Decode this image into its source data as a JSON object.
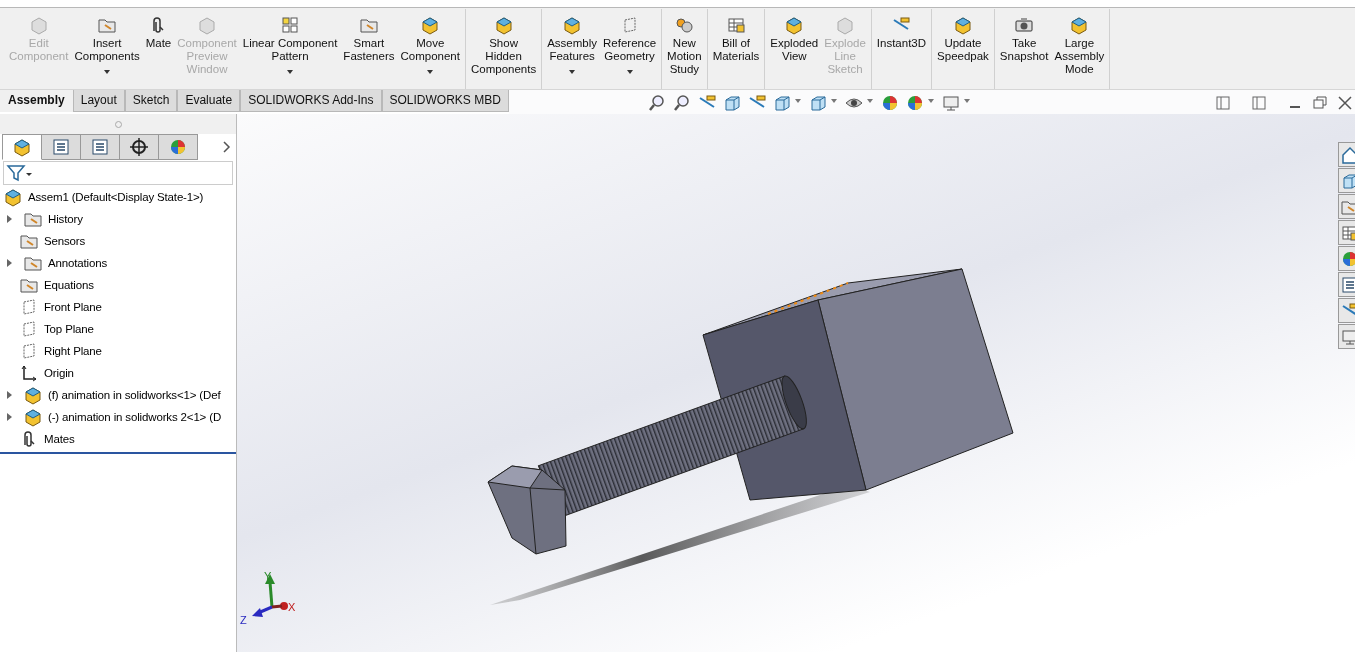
{
  "ribbon": {
    "groups": [
      [
        {
          "label": "Edit\nComponent",
          "disabled": true,
          "dropdown": false
        },
        {
          "label": "Insert\nComponents",
          "disabled": false,
          "dropdown": true
        },
        {
          "label": "Mate",
          "disabled": false,
          "dropdown": false
        },
        {
          "label": "Component\nPreview\nWindow",
          "disabled": true,
          "dropdown": false
        },
        {
          "label": "Linear Component\nPattern",
          "disabled": false,
          "dropdown": true
        },
        {
          "label": "Smart\nFasteners",
          "disabled": false,
          "dropdown": false
        },
        {
          "label": "Move\nComponent",
          "disabled": false,
          "dropdown": true
        }
      ],
      [
        {
          "label": "Show\nHidden\nComponents",
          "disabled": false,
          "dropdown": false
        }
      ],
      [
        {
          "label": "Assembly\nFeatures",
          "disabled": false,
          "dropdown": true
        },
        {
          "label": "Reference\nGeometry",
          "disabled": false,
          "dropdown": true
        }
      ],
      [
        {
          "label": "New\nMotion\nStudy",
          "disabled": false,
          "dropdown": false
        }
      ],
      [
        {
          "label": "Bill of\nMaterials",
          "disabled": false,
          "dropdown": false
        }
      ],
      [
        {
          "label": "Exploded\nView",
          "disabled": false,
          "dropdown": false
        },
        {
          "label": "Explode\nLine\nSketch",
          "disabled": true,
          "dropdown": false
        }
      ],
      [
        {
          "label": "Instant3D",
          "disabled": false,
          "dropdown": false
        }
      ],
      [
        {
          "label": "Update\nSpeedpak",
          "disabled": false,
          "dropdown": false
        }
      ],
      [
        {
          "label": "Take\nSnapshot",
          "disabled": false,
          "dropdown": false
        },
        {
          "label": "Large\nAssembly\nMode",
          "disabled": false,
          "dropdown": false
        }
      ]
    ]
  },
  "tabs": [
    {
      "label": "Assembly",
      "selected": true
    },
    {
      "label": "Layout",
      "selected": false
    },
    {
      "label": "Sketch",
      "selected": false
    },
    {
      "label": "Evaluate",
      "selected": false
    },
    {
      "label": "SOLIDWORKS Add-Ins",
      "selected": false
    },
    {
      "label": "SOLIDWORKS MBD",
      "selected": false
    }
  ],
  "panel_tabs": [
    {
      "selected": true
    },
    {
      "selected": false
    },
    {
      "selected": false
    },
    {
      "selected": false
    },
    {
      "selected": false
    }
  ],
  "tree": {
    "label": "Assem1  (Default<Display State-1>)",
    "children": [
      {
        "label": "History",
        "collapsed": true
      },
      {
        "label": "Sensors",
        "collapsed": false
      },
      {
        "label": "Annotations",
        "collapsed": true
      },
      {
        "label": "Equations",
        "collapsed": false
      },
      {
        "label": "Front Plane",
        "collapsed": false
      },
      {
        "label": "Top Plane",
        "collapsed": false
      },
      {
        "label": "Right Plane",
        "collapsed": false
      },
      {
        "label": "Origin",
        "collapsed": false
      },
      {
        "label": "(f) animation in solidworks<1> (Def",
        "collapsed": true
      },
      {
        "label": "(-) animation in solidworks 2<1> (D",
        "collapsed": true
      },
      {
        "label": "Mates",
        "collapsed": false
      }
    ]
  },
  "triad": [
    "Y",
    "X",
    "Z"
  ]
}
